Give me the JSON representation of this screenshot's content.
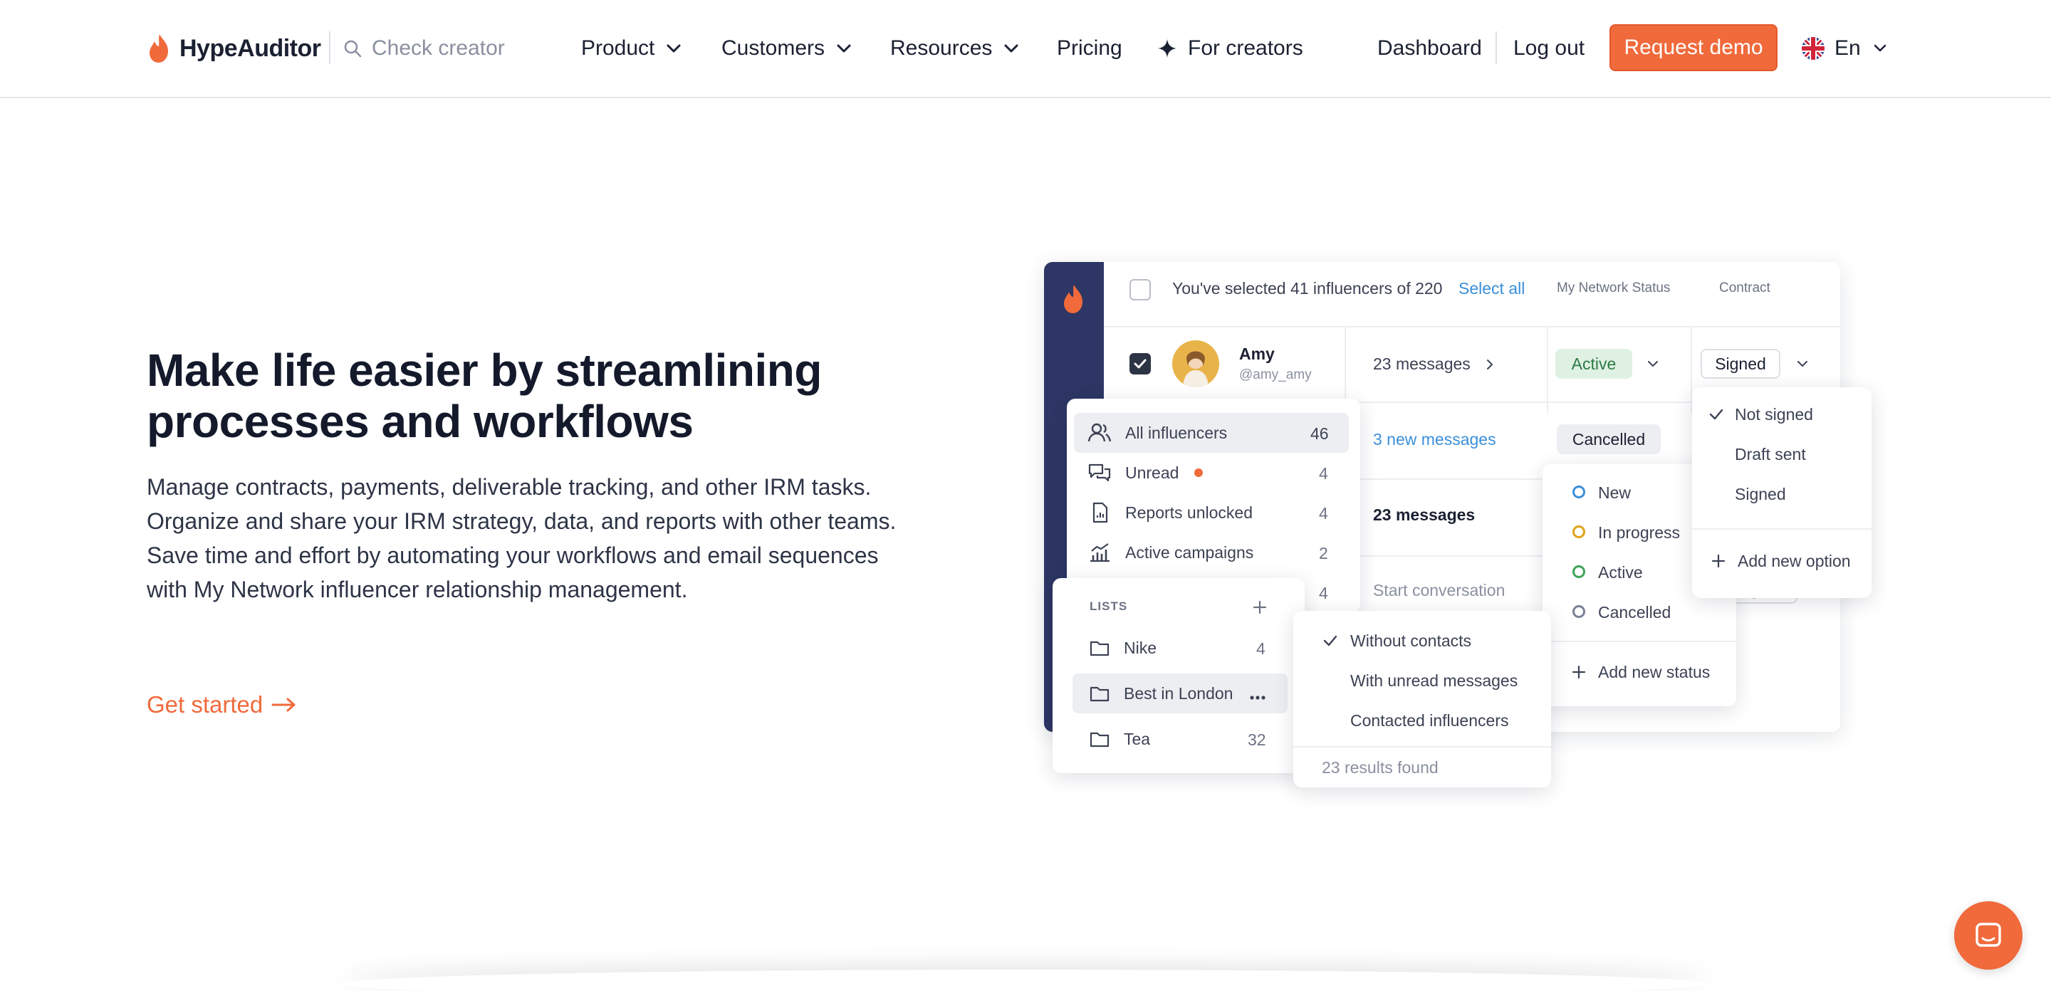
{
  "nav": {
    "logo_text": "HypeAuditor",
    "search_placeholder": "Check creator",
    "menu": [
      "Product",
      "Customers",
      "Resources",
      "Pricing",
      "For creators"
    ],
    "dashboard": "Dashboard",
    "logout": "Log out",
    "request_demo": "Request demo",
    "language": "En",
    "accent_color": "#f06a3b"
  },
  "hero": {
    "title": "Make life easier by streamlining processes and workflows",
    "description": "Manage contracts, payments, deliverable tracking, and other IRM tasks. Organize and share your IRM strategy, data, and reports with other teams. Save time and effort by automating your workflows and email sequences with My Network influencer relationship management.",
    "cta": "Get started"
  },
  "mockup": {
    "selection_text": "You've selected 41 influencers of 220",
    "select_all": "Select all",
    "col_status": "My Network Status",
    "col_contract": "Contract",
    "row1": {
      "name": "Amy",
      "handle": "@amy_amy",
      "messages": "23 messages",
      "status": "Active",
      "contract": "Signed"
    },
    "row2": {
      "messages": "3 new messages",
      "status": "Cancelled"
    },
    "row3": {
      "messages": "23 messages"
    },
    "row4": {
      "messages": "Start conversation"
    },
    "filters": [
      {
        "label": "All influencers",
        "count": "46",
        "icon": "users-icon"
      },
      {
        "label": "Unread",
        "count": "4",
        "icon": "chat-icon"
      },
      {
        "label": "Reports unlocked",
        "count": "4",
        "icon": "report-icon"
      },
      {
        "label": "Active campaigns",
        "count": "2",
        "icon": "chart-icon"
      }
    ],
    "hidden_count": "4",
    "lists_heading": "LISTS",
    "lists": [
      {
        "label": "Nike",
        "count": "4"
      },
      {
        "label": "Best in London",
        "count": ""
      },
      {
        "label": "Tea",
        "count": "32"
      }
    ],
    "contact_filters": [
      "Without contacts",
      "With unread messages",
      "Contacted influencers"
    ],
    "results": "23 results found",
    "statuses": [
      {
        "label": "New",
        "color": "#3b8fd9"
      },
      {
        "label": "In progress",
        "color": "#e0a21b"
      },
      {
        "label": "Active",
        "color": "#41a35a"
      },
      {
        "label": "Cancelled",
        "color": "#7a8196"
      }
    ],
    "add_status": "Add new status",
    "contract_options": [
      "Not signed",
      "Draft sent",
      "Signed"
    ],
    "add_option": "Add new option"
  }
}
